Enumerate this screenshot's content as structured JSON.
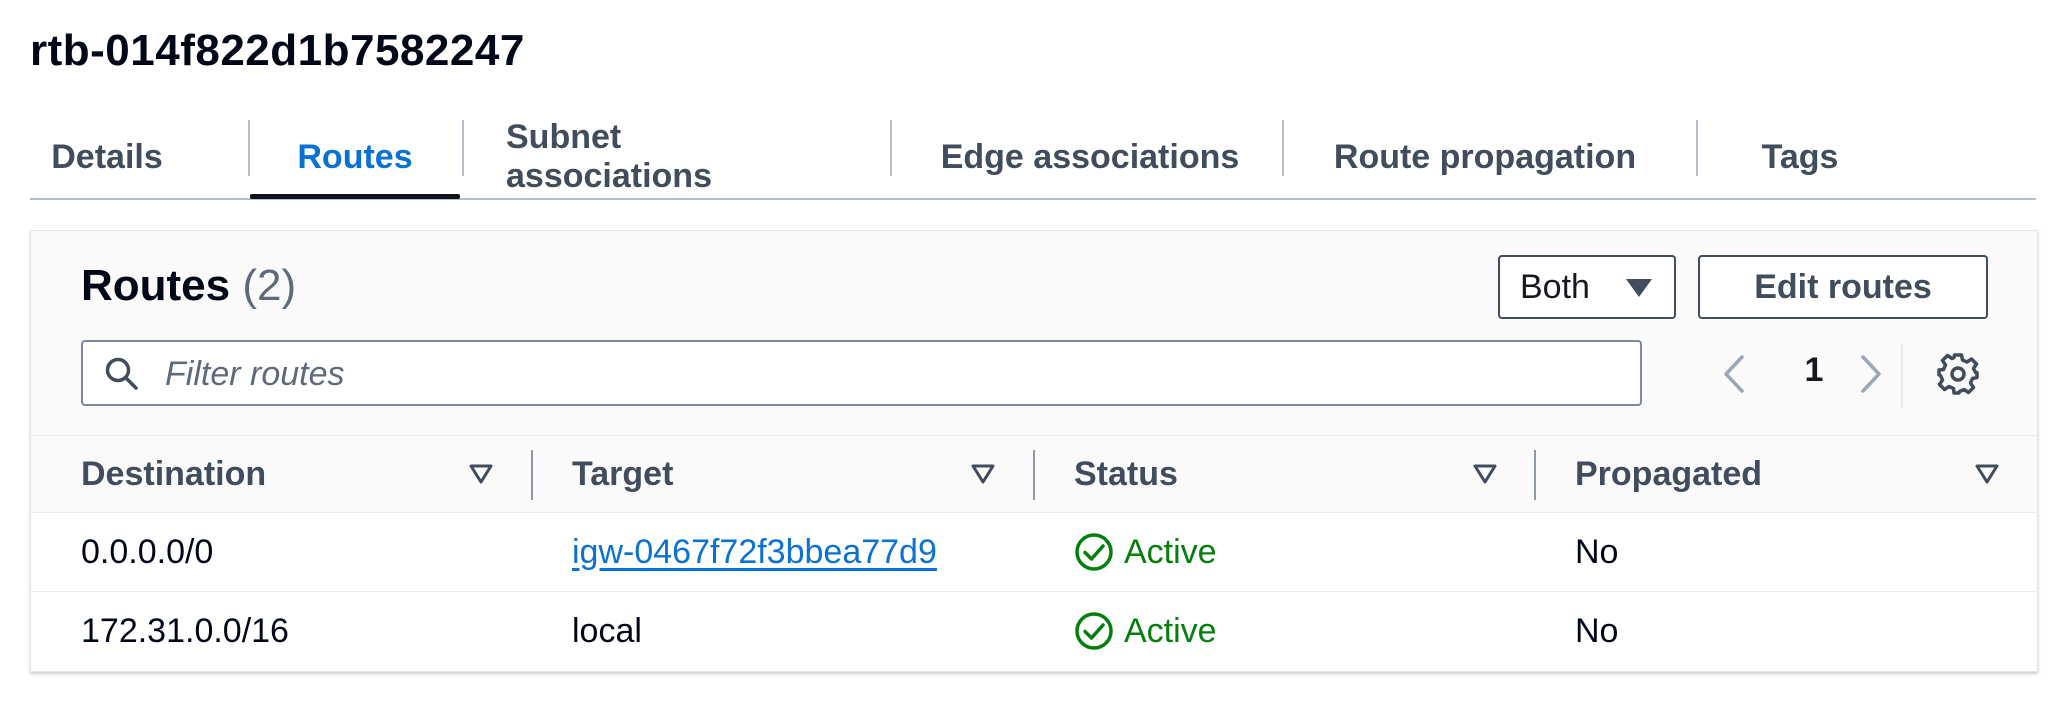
{
  "page": {
    "title": "rtb-014f822d1b7582247"
  },
  "tabs": [
    {
      "label": "Details"
    },
    {
      "label": "Routes",
      "active": true
    },
    {
      "label": "Subnet associations"
    },
    {
      "label": "Edge associations"
    },
    {
      "label": "Route propagation"
    },
    {
      "label": "Tags"
    }
  ],
  "routes_panel": {
    "title": "Routes",
    "count": "(2)",
    "filter_select": {
      "selected": "Both"
    },
    "edit_button": "Edit routes",
    "search": {
      "placeholder": "Filter routes",
      "value": ""
    },
    "pagination": {
      "current_page": "1"
    }
  },
  "table": {
    "columns": [
      "Destination",
      "Target",
      "Status",
      "Propagated"
    ],
    "rows": [
      {
        "destination": "0.0.0.0/0",
        "target": "igw-0467f72f3bbea77d9",
        "target_is_link": true,
        "status": "Active",
        "propagated": "No"
      },
      {
        "destination": "172.31.0.0/16",
        "target": "local",
        "target_is_link": false,
        "status": "Active",
        "propagated": "No"
      }
    ]
  },
  "icons": {
    "search": "search-icon",
    "prev": "chevron-left-icon",
    "next": "chevron-right-icon",
    "settings": "gear-icon",
    "sort": "sort-caret-down-icon",
    "status": "check-circle-icon",
    "dropdown": "caret-down-icon"
  },
  "colors": {
    "accent": "#0972d3",
    "success": "#037f0c",
    "text_strong": "#000716",
    "text_secondary": "#414d5c"
  }
}
